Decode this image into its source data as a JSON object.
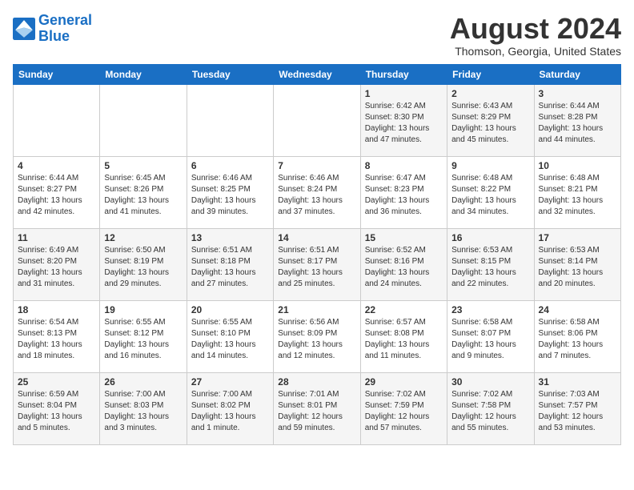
{
  "header": {
    "logo_line1": "General",
    "logo_line2": "Blue",
    "month_year": "August 2024",
    "location": "Thomson, Georgia, United States"
  },
  "weekdays": [
    "Sunday",
    "Monday",
    "Tuesday",
    "Wednesday",
    "Thursday",
    "Friday",
    "Saturday"
  ],
  "weeks": [
    [
      {
        "day": "",
        "data": ""
      },
      {
        "day": "",
        "data": ""
      },
      {
        "day": "",
        "data": ""
      },
      {
        "day": "",
        "data": ""
      },
      {
        "day": "1",
        "data": "Sunrise: 6:42 AM\nSunset: 8:30 PM\nDaylight: 13 hours and 47 minutes."
      },
      {
        "day": "2",
        "data": "Sunrise: 6:43 AM\nSunset: 8:29 PM\nDaylight: 13 hours and 45 minutes."
      },
      {
        "day": "3",
        "data": "Sunrise: 6:44 AM\nSunset: 8:28 PM\nDaylight: 13 hours and 44 minutes."
      }
    ],
    [
      {
        "day": "4",
        "data": "Sunrise: 6:44 AM\nSunset: 8:27 PM\nDaylight: 13 hours and 42 minutes."
      },
      {
        "day": "5",
        "data": "Sunrise: 6:45 AM\nSunset: 8:26 PM\nDaylight: 13 hours and 41 minutes."
      },
      {
        "day": "6",
        "data": "Sunrise: 6:46 AM\nSunset: 8:25 PM\nDaylight: 13 hours and 39 minutes."
      },
      {
        "day": "7",
        "data": "Sunrise: 6:46 AM\nSunset: 8:24 PM\nDaylight: 13 hours and 37 minutes."
      },
      {
        "day": "8",
        "data": "Sunrise: 6:47 AM\nSunset: 8:23 PM\nDaylight: 13 hours and 36 minutes."
      },
      {
        "day": "9",
        "data": "Sunrise: 6:48 AM\nSunset: 8:22 PM\nDaylight: 13 hours and 34 minutes."
      },
      {
        "day": "10",
        "data": "Sunrise: 6:48 AM\nSunset: 8:21 PM\nDaylight: 13 hours and 32 minutes."
      }
    ],
    [
      {
        "day": "11",
        "data": "Sunrise: 6:49 AM\nSunset: 8:20 PM\nDaylight: 13 hours and 31 minutes."
      },
      {
        "day": "12",
        "data": "Sunrise: 6:50 AM\nSunset: 8:19 PM\nDaylight: 13 hours and 29 minutes."
      },
      {
        "day": "13",
        "data": "Sunrise: 6:51 AM\nSunset: 8:18 PM\nDaylight: 13 hours and 27 minutes."
      },
      {
        "day": "14",
        "data": "Sunrise: 6:51 AM\nSunset: 8:17 PM\nDaylight: 13 hours and 25 minutes."
      },
      {
        "day": "15",
        "data": "Sunrise: 6:52 AM\nSunset: 8:16 PM\nDaylight: 13 hours and 24 minutes."
      },
      {
        "day": "16",
        "data": "Sunrise: 6:53 AM\nSunset: 8:15 PM\nDaylight: 13 hours and 22 minutes."
      },
      {
        "day": "17",
        "data": "Sunrise: 6:53 AM\nSunset: 8:14 PM\nDaylight: 13 hours and 20 minutes."
      }
    ],
    [
      {
        "day": "18",
        "data": "Sunrise: 6:54 AM\nSunset: 8:13 PM\nDaylight: 13 hours and 18 minutes."
      },
      {
        "day": "19",
        "data": "Sunrise: 6:55 AM\nSunset: 8:12 PM\nDaylight: 13 hours and 16 minutes."
      },
      {
        "day": "20",
        "data": "Sunrise: 6:55 AM\nSunset: 8:10 PM\nDaylight: 13 hours and 14 minutes."
      },
      {
        "day": "21",
        "data": "Sunrise: 6:56 AM\nSunset: 8:09 PM\nDaylight: 13 hours and 12 minutes."
      },
      {
        "day": "22",
        "data": "Sunrise: 6:57 AM\nSunset: 8:08 PM\nDaylight: 13 hours and 11 minutes."
      },
      {
        "day": "23",
        "data": "Sunrise: 6:58 AM\nSunset: 8:07 PM\nDaylight: 13 hours and 9 minutes."
      },
      {
        "day": "24",
        "data": "Sunrise: 6:58 AM\nSunset: 8:06 PM\nDaylight: 13 hours and 7 minutes."
      }
    ],
    [
      {
        "day": "25",
        "data": "Sunrise: 6:59 AM\nSunset: 8:04 PM\nDaylight: 13 hours and 5 minutes."
      },
      {
        "day": "26",
        "data": "Sunrise: 7:00 AM\nSunset: 8:03 PM\nDaylight: 13 hours and 3 minutes."
      },
      {
        "day": "27",
        "data": "Sunrise: 7:00 AM\nSunset: 8:02 PM\nDaylight: 13 hours and 1 minute."
      },
      {
        "day": "28",
        "data": "Sunrise: 7:01 AM\nSunset: 8:01 PM\nDaylight: 12 hours and 59 minutes."
      },
      {
        "day": "29",
        "data": "Sunrise: 7:02 AM\nSunset: 7:59 PM\nDaylight: 12 hours and 57 minutes."
      },
      {
        "day": "30",
        "data": "Sunrise: 7:02 AM\nSunset: 7:58 PM\nDaylight: 12 hours and 55 minutes."
      },
      {
        "day": "31",
        "data": "Sunrise: 7:03 AM\nSunset: 7:57 PM\nDaylight: 12 hours and 53 minutes."
      }
    ]
  ]
}
